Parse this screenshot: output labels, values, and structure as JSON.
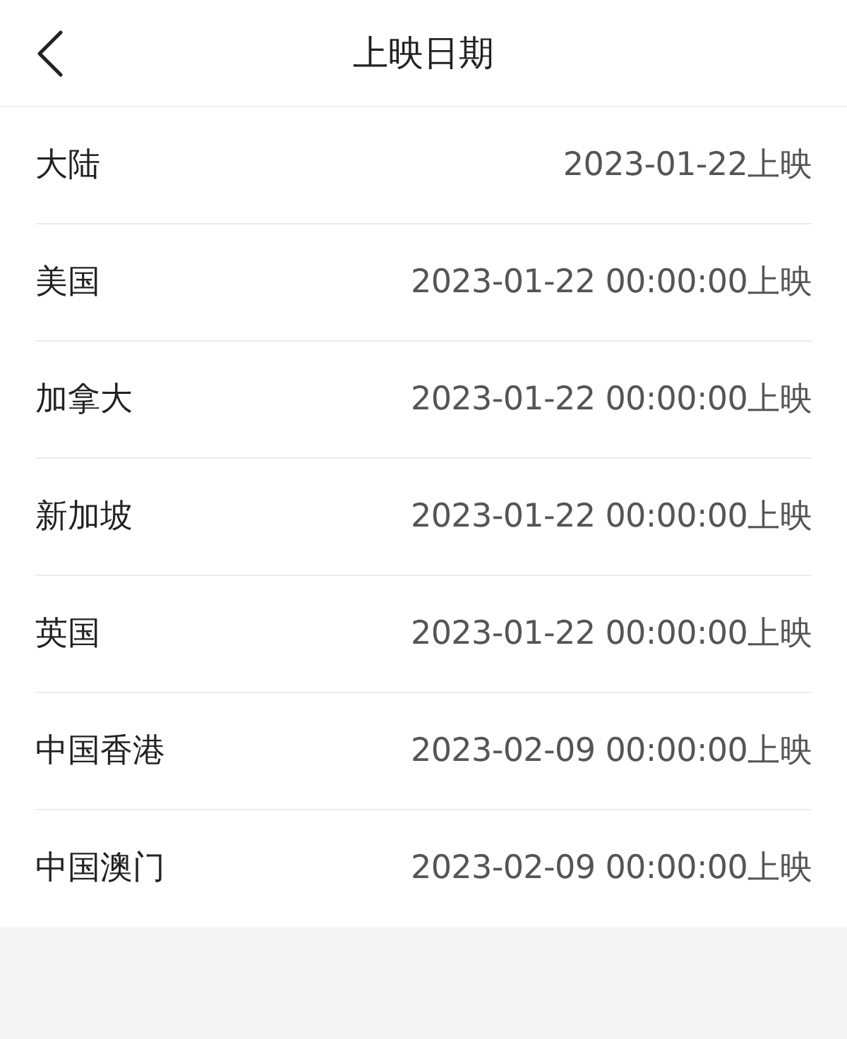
{
  "header": {
    "title": "上映日期"
  },
  "rows": [
    {
      "region": "大陆",
      "date": "2023-01-22上映"
    },
    {
      "region": "美国",
      "date": "2023-01-22 00:00:00上映"
    },
    {
      "region": "加拿大",
      "date": "2023-01-22 00:00:00上映"
    },
    {
      "region": "新加坡",
      "date": "2023-01-22 00:00:00上映"
    },
    {
      "region": "英国",
      "date": "2023-01-22 00:00:00上映"
    },
    {
      "region": "中国香港",
      "date": "2023-02-09 00:00:00上映"
    },
    {
      "region": "中国澳门",
      "date": "2023-02-09 00:00:00上映"
    }
  ]
}
